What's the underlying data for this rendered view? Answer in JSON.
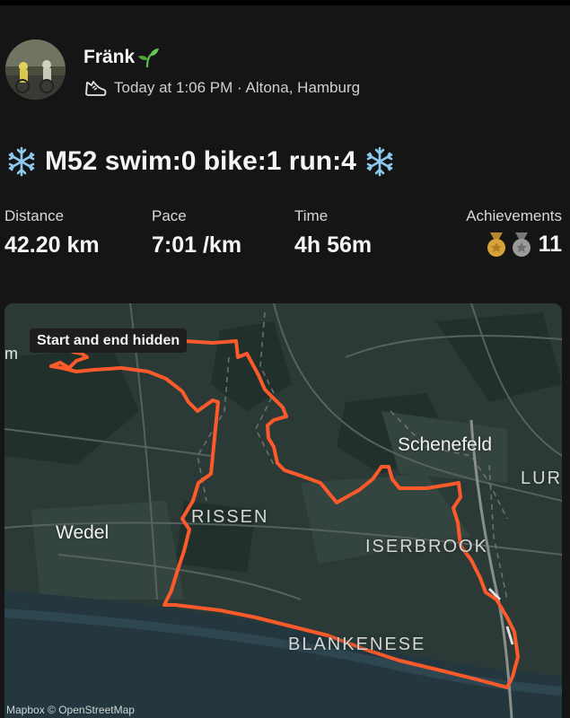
{
  "header": {
    "athlete_name": "Fränk",
    "timestamp": "Today at 1:06 PM",
    "location": "Altona, Hamburg",
    "separator": "·"
  },
  "activity": {
    "title": "M52 swim:0 bike:1 run:4",
    "title_icon": "snowflake-icon",
    "type_icon": "running-shoe-icon"
  },
  "stats": {
    "distance": {
      "label": "Distance",
      "value": "42.20 km"
    },
    "pace": {
      "label": "Pace",
      "value": "7:01 /km"
    },
    "time": {
      "label": "Time",
      "value": "4h 56m"
    },
    "achievements": {
      "label": "Achievements",
      "count": "11",
      "icons": [
        "gold-medal-icon",
        "silver-medal-icon"
      ]
    }
  },
  "map": {
    "badge": "Start and end hidden",
    "edge_text": "m",
    "places": {
      "schenefeld": "Schenefeld",
      "lur": "LUR",
      "wedel": "Wedel",
      "rissen": "RISSEN",
      "iserbrook": "ISERBROOK",
      "blankenese": "BLANKENESE"
    },
    "attribution": "Mapbox © OpenStreetMap"
  },
  "colors": {
    "background": "#151515",
    "route": "#fc5a2a",
    "map_land": "#2b3a36",
    "map_water": "#24373f",
    "gold": "#d8a23a",
    "silver": "#9a9a9a"
  }
}
